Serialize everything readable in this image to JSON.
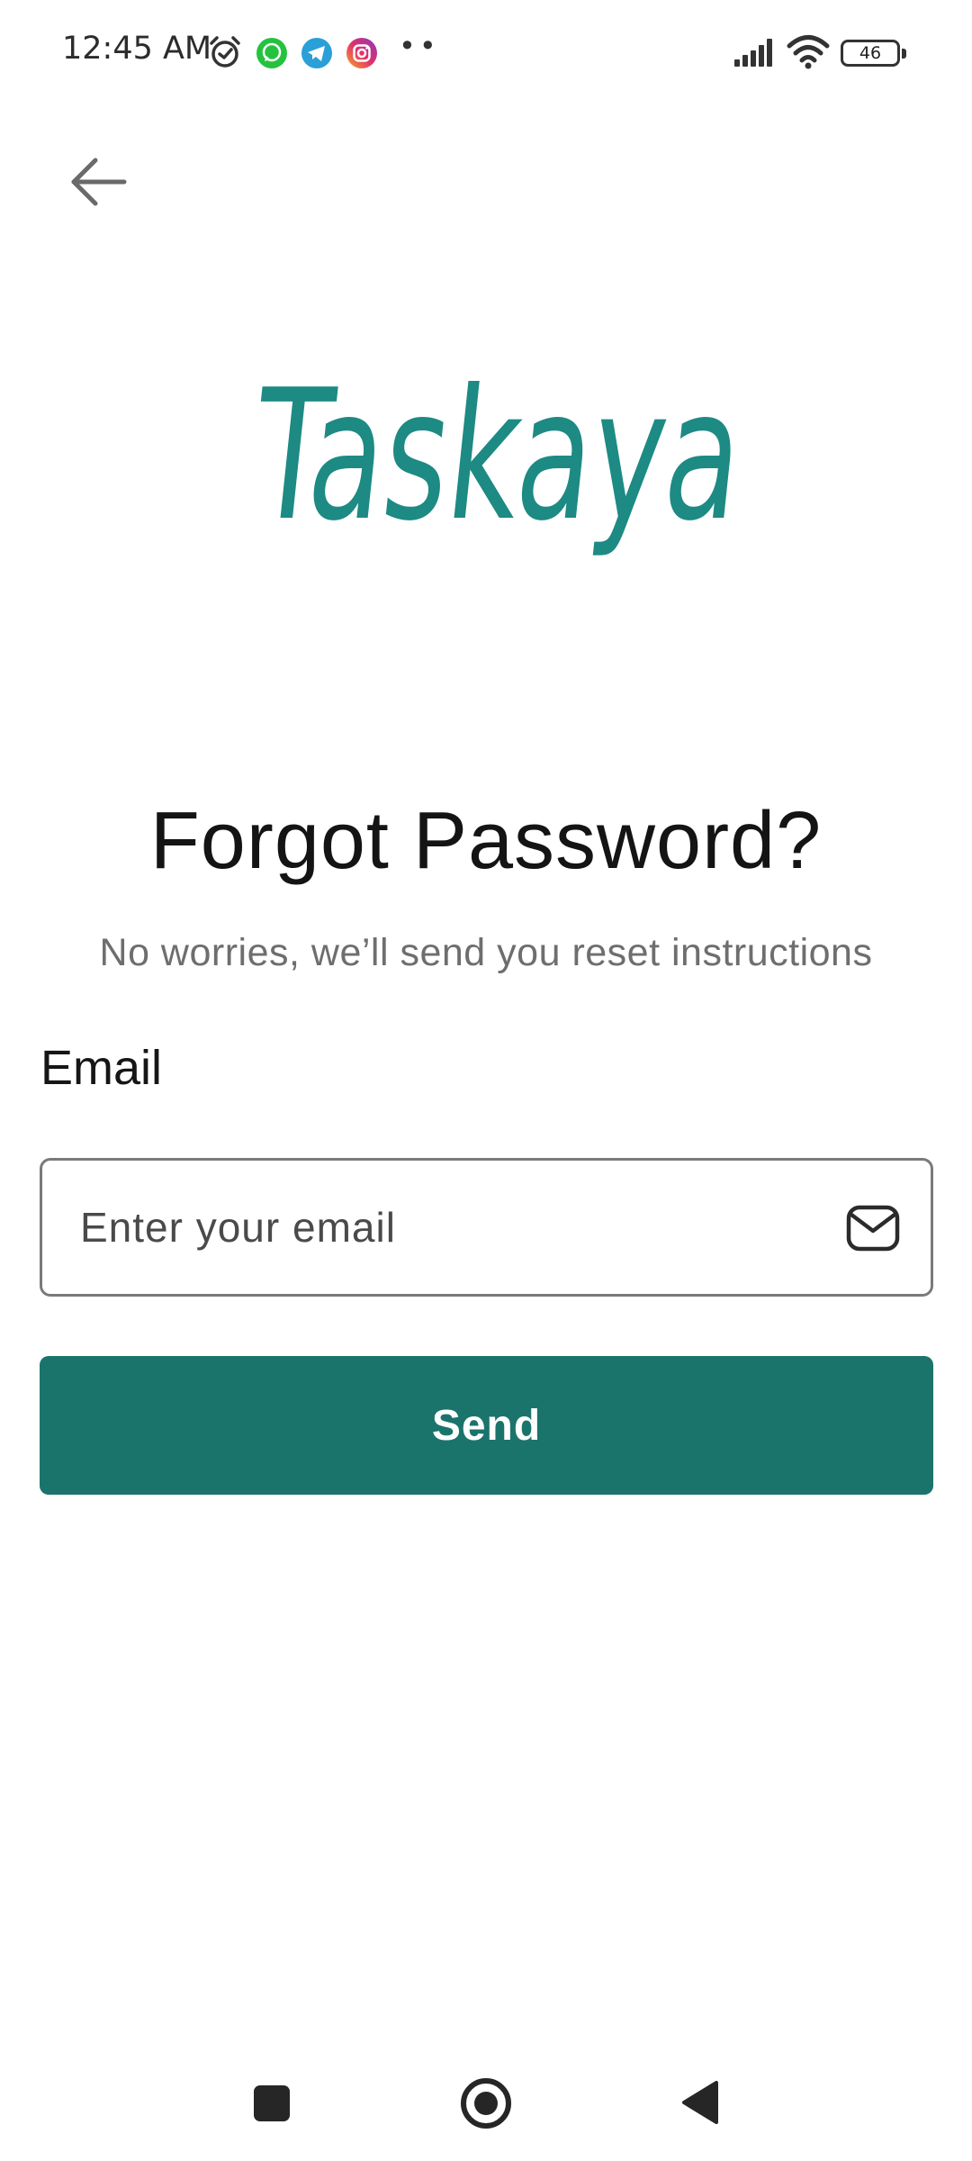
{
  "status_bar": {
    "time": "12:45 AM",
    "notification_icons": [
      "alarm-icon",
      "whatsapp-icon",
      "telegram-icon",
      "instagram-icon"
    ],
    "more_indicator": "••",
    "battery_level": "46"
  },
  "header": {
    "back_icon": "arrow-left-icon"
  },
  "logo": {
    "text": "Taskaya",
    "color": "#1d8a84"
  },
  "main": {
    "title": "Forgot Password?",
    "subtitle": "No worries, we’ll send you reset instructions",
    "email_label": "Email",
    "email_placeholder": "Enter your email",
    "email_value": "",
    "email_icon": "mail-icon",
    "send_label": "Send"
  },
  "colors": {
    "primary": "#1b746c",
    "title_text": "#141414",
    "subtitle_text": "#6e6e6e",
    "input_border": "#7a7a7a"
  },
  "system_nav": {
    "recents_icon": "square-icon",
    "home_icon": "circle-home-icon",
    "back_icon": "triangle-back-icon"
  }
}
